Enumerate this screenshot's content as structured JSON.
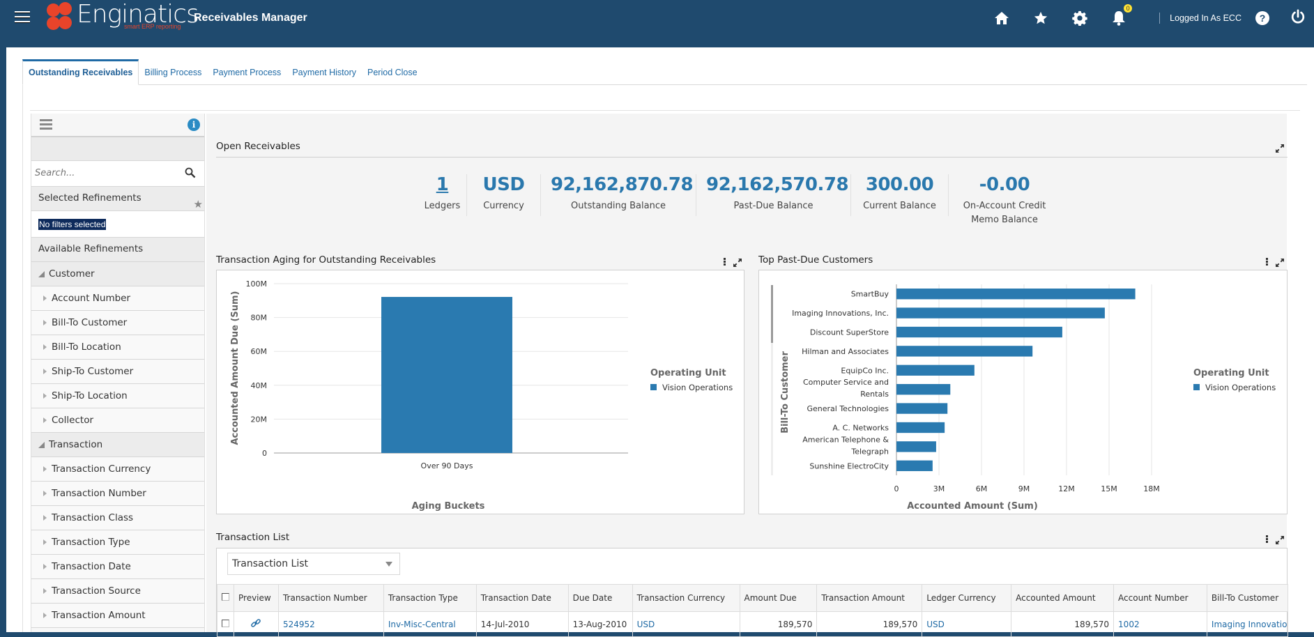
{
  "header": {
    "logo_text": "Enginatics",
    "logo_tagline": "smart ERP reporting",
    "app_title": "Receivables Manager",
    "notifications_count": "0",
    "logged_in_label": "Logged In As ECC",
    "help_label": "?",
    "icons": [
      "menu-icon",
      "home-icon",
      "star-icon",
      "gear-icon",
      "bell-icon",
      "help-icon",
      "power-icon"
    ]
  },
  "tabs": [
    {
      "label": "Outstanding Receivables",
      "active": true
    },
    {
      "label": "Billing Process",
      "active": false
    },
    {
      "label": "Payment Process",
      "active": false
    },
    {
      "label": "Payment History",
      "active": false
    },
    {
      "label": "Period Close",
      "active": false
    }
  ],
  "sidebar": {
    "search_placeholder": "Search...",
    "selected_refinements_label": "Selected Refinements",
    "no_filters_label": "No filters selected",
    "available_refinements_label": "Available Refinements",
    "groups": [
      {
        "label": "Customer",
        "items": [
          "Account Number",
          "Bill-To Customer",
          "Bill-To Location",
          "Ship-To Customer",
          "Ship-To Location",
          "Collector"
        ]
      },
      {
        "label": "Transaction",
        "items": [
          "Transaction Currency",
          "Transaction Number",
          "Transaction Class",
          "Transaction Type",
          "Transaction Date",
          "Transaction Source",
          "Transaction Amount"
        ]
      }
    ]
  },
  "open_receivables": {
    "title": "Open Receivables",
    "kpis": [
      {
        "value": "1",
        "label": "Ledgers",
        "link": true
      },
      {
        "value": "USD",
        "label": "Currency",
        "link": false
      },
      {
        "value": "92,162,870.78",
        "label": "Outstanding Balance",
        "link": false
      },
      {
        "value": "92,162,570.78",
        "label": "Past-Due Balance",
        "link": false
      },
      {
        "value": "300.00",
        "label": "Current Balance",
        "link": false
      },
      {
        "value": "-0.00",
        "label": "On-Account Credit Memo Balance",
        "label_line1": "On-Account Credit",
        "label_line2": "Memo Balance",
        "link": false
      }
    ]
  },
  "colors": {
    "brand_header": "#1f4a6e",
    "accent": "#2a78ad",
    "bar": "#2a7ab0",
    "logo": "#e8442a"
  },
  "chart_data": [
    {
      "type": "bar",
      "title": "Transaction Aging for Outstanding Receivables",
      "categories": [
        "Over 90 Days"
      ],
      "series": [
        {
          "name": "Vision Operations",
          "values": [
            92162870.78
          ]
        }
      ],
      "xlabel": "Aging Buckets",
      "ylabel": "Accounted Amount Due (Sum)",
      "ylim": [
        0,
        100000000
      ],
      "yticks": [
        0,
        20000000,
        40000000,
        60000000,
        80000000,
        100000000
      ],
      "ytick_labels": [
        "0",
        "20M",
        "40M",
        "60M",
        "80M",
        "100M"
      ],
      "legend_title": "Operating Unit",
      "legend_position": "right",
      "grid": true
    },
    {
      "type": "bar",
      "orientation": "horizontal",
      "title": "Top Past-Due Customers",
      "categories": [
        "SmartBuy",
        "Imaging Innovations, Inc.",
        "Discount SuperStore",
        "Hilman and Associates",
        "EquipCo Inc.",
        "Computer Service and Rentals",
        "General Technologies",
        "A. C. Networks",
        "American Telephone & Telegraph",
        "Sunshine ElectroCity"
      ],
      "category_lines": [
        [
          "SmartBuy"
        ],
        [
          "Imaging Innovations, Inc."
        ],
        [
          "Discount SuperStore"
        ],
        [
          "Hilman and Associates"
        ],
        [
          "EquipCo Inc."
        ],
        [
          "Computer Service and",
          "Rentals"
        ],
        [
          "General Technologies"
        ],
        [
          "A. C. Networks"
        ],
        [
          "American Telephone &",
          "Telegraph"
        ],
        [
          "Sunshine ElectroCity"
        ]
      ],
      "series": [
        {
          "name": "Vision Operations",
          "values": [
            16850000,
            14700000,
            11700000,
            9600000,
            5500000,
            3800000,
            3600000,
            3400000,
            2800000,
            2550000
          ]
        }
      ],
      "xlabel": "Accounted Amount (Sum)",
      "ylabel": "Bill-To Customer",
      "xlim": [
        0,
        18000000
      ],
      "xticks": [
        0,
        3000000,
        6000000,
        9000000,
        12000000,
        15000000,
        18000000
      ],
      "xtick_labels": [
        "0",
        "3M",
        "6M",
        "9M",
        "12M",
        "15M",
        "18M"
      ],
      "legend_title": "Operating Unit",
      "legend_position": "right",
      "grid": true
    }
  ],
  "transaction_list": {
    "title": "Transaction List",
    "view_selector_value": "Transaction List",
    "columns": [
      "",
      "Preview",
      "Transaction Number",
      "Transaction Type",
      "Transaction Date",
      "Due Date",
      "Transaction Currency",
      "Amount Due",
      "Transaction Amount",
      "Ledger Currency",
      "Accounted Amount",
      "Account Number",
      "Bill-To Customer"
    ],
    "rows": [
      {
        "transaction_number": "524952",
        "transaction_type": "Inv-Misc-Central",
        "transaction_date": "14-Jul-2010",
        "due_date": "13-Aug-2010",
        "transaction_currency": "USD",
        "amount_due": "189,570",
        "transaction_amount": "189,570",
        "ledger_currency": "USD",
        "accounted_amount": "189,570",
        "account_number": "1002",
        "bill_to_customer": "Imaging Innovations, Inc."
      }
    ]
  }
}
